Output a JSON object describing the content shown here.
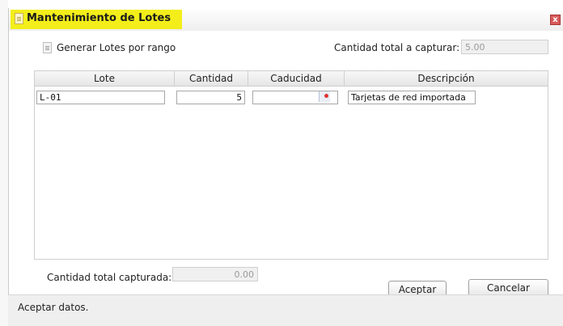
{
  "dialog": {
    "title": "Mantenimiento de Lotes",
    "close_label": "x"
  },
  "top": {
    "generate_label": "Generar Lotes por rango",
    "total_to_capture_label": "Cantidad total a capturar:",
    "total_to_capture_value": "5.00"
  },
  "grid": {
    "columns": [
      "Lote",
      "Cantidad",
      "Caducidad",
      "Descripción"
    ],
    "rows": [
      {
        "lote": "L-01",
        "cantidad": "5",
        "caducidad": "",
        "descripcion": "Tarjetas de red importada"
      }
    ]
  },
  "bottom": {
    "total_captured_label": "Cantidad total capturada:",
    "total_captured_value": "0.00",
    "accept_label": "Aceptar",
    "cancel_label": "Cancelar"
  },
  "status": {
    "text": "Aceptar datos."
  },
  "colors": {
    "title_highlight": "#f3ee1a",
    "close_button": "#d85a5a"
  },
  "icons": [
    "document-icon",
    "close-icon",
    "calendar-icon"
  ]
}
